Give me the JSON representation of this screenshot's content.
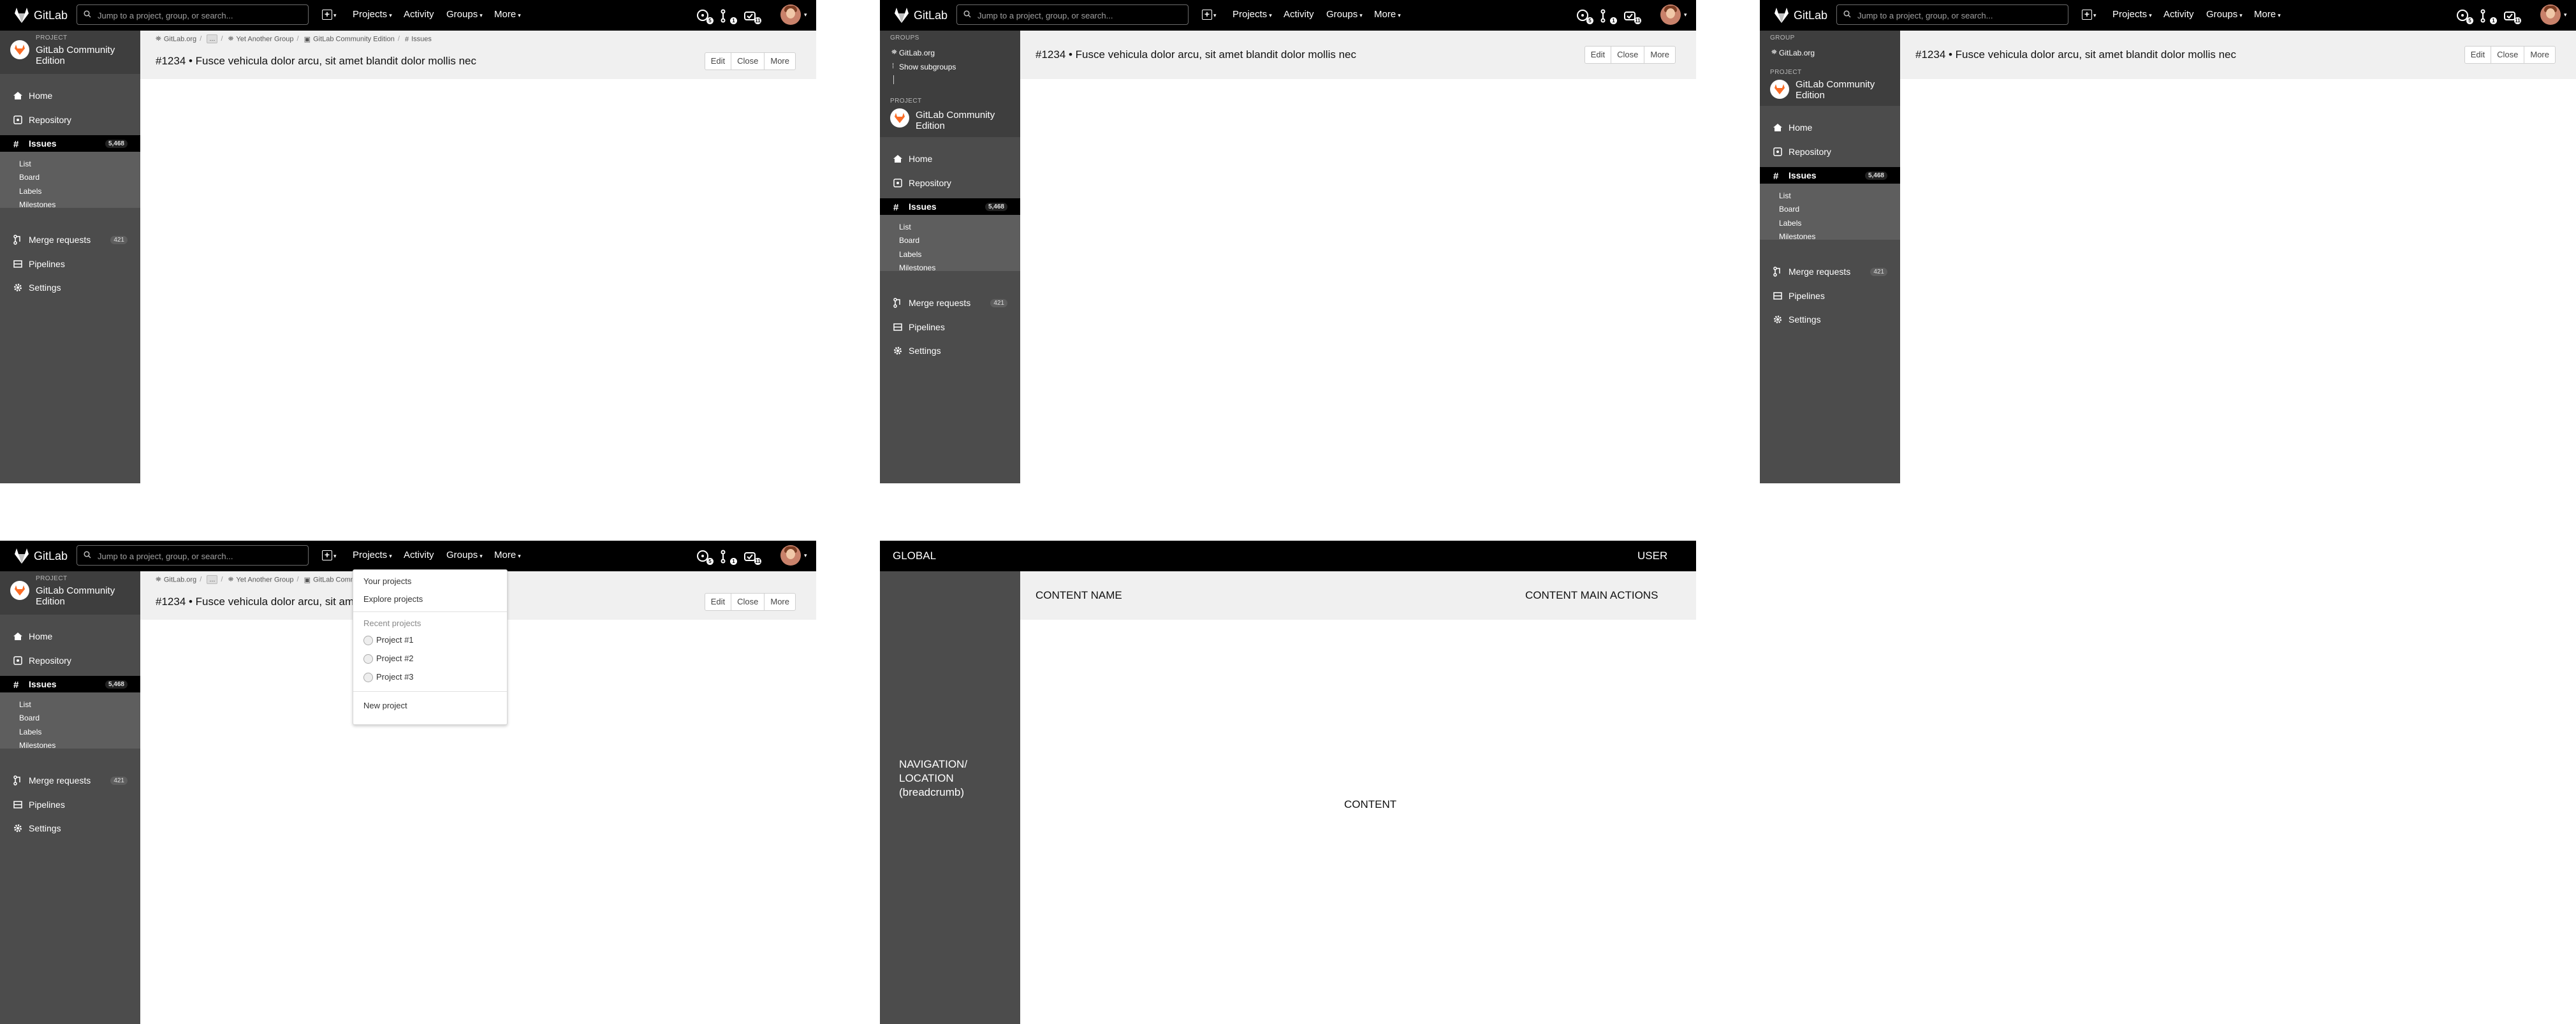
{
  "nav": {
    "brand": "GitLab",
    "search_placeholder": "Jump to a project, group, or search...",
    "projects": "Projects",
    "activity": "Activity",
    "groups": "Groups",
    "more": "More",
    "badges": {
      "issues": "5",
      "mr": "1",
      "todos": "11"
    }
  },
  "context": {
    "project_label": "PROJECT",
    "group_label": "GROUP",
    "groups_label": "GROUPS",
    "project_name_line1": "GitLab Community",
    "project_name_line2": "Edition",
    "group_name": "GitLab.org",
    "show_subgroups": "Show subgroups"
  },
  "sidebar": {
    "home": "Home",
    "repository": "Repository",
    "issues": "Issues",
    "issues_count": "5,468",
    "sub": [
      "List",
      "Board",
      "Labels",
      "Milestones"
    ],
    "merge_requests": "Merge requests",
    "mr_count": "421",
    "pipelines": "Pipelines",
    "settings": "Settings"
  },
  "breadcrumb": {
    "gitlab": "GitLab.org",
    "ellipsis": "...",
    "group": "Yet Another Group",
    "project": "GitLab Community Edition",
    "issues": "Issues"
  },
  "issue": {
    "title": "#1234 • Fusce vehicula dolor arcu, sit amet blandit dolor mollis nec",
    "edit": "Edit",
    "close": "Close",
    "more": "More"
  },
  "projects_dropdown": {
    "your_projects": "Your projects",
    "explore_projects": "Explore projects",
    "recent_header": "Recent projects",
    "recent": [
      "Project #1",
      "Project #2",
      "Project #3"
    ],
    "new_project": "New project"
  },
  "wireframe": {
    "global": "GLOBAL",
    "user": "USER",
    "content_name": "CONTENT NAME",
    "content_main_actions": "CONTENT MAIN ACTIONS",
    "nav_line1": "NAVIGATION/",
    "nav_line2": "LOCATION",
    "nav_line3": "(breadcrumb)",
    "content": "CONTENT"
  },
  "colors": {
    "topbar": "#000000",
    "sidebar": "#4c4c4c",
    "content_header": "#f0f0f0",
    "gitlab_orange": "#fc6d26"
  }
}
